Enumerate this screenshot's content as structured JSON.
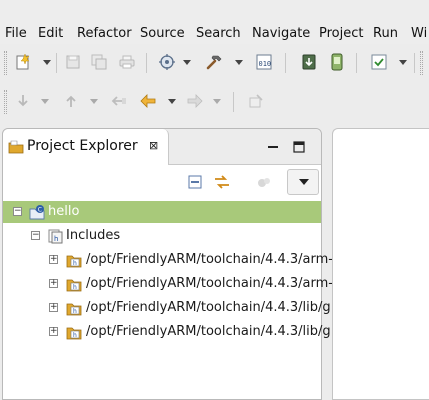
{
  "menu": {
    "file": "File",
    "edit": "Edit",
    "refactor": "Refactor",
    "source": "Source",
    "search": "Search",
    "navigate": "Navigate",
    "project": "Project",
    "run": "Run",
    "window": "Wi"
  },
  "toolbar1": {
    "icons": [
      "new-wizard-icon",
      "save-icon",
      "save-all-icon",
      "print-icon",
      "debug-settings-icon",
      "build-hammer-icon",
      "binary-icon",
      "download-icon",
      "device-icon",
      "task-check-icon"
    ]
  },
  "toolbar2": {
    "icons": [
      "next-annotation-icon",
      "previous-annotation-icon",
      "last-edit-location-icon",
      "back-icon",
      "forward-icon",
      "pin-editor-icon"
    ]
  },
  "explorer": {
    "title": "Project Explorer",
    "close_glyph": "⊠",
    "view_menu_icon": "view-menu-icon"
  },
  "tree": {
    "project": "hello",
    "includes": "Includes",
    "paths": [
      "/opt/FriendlyARM/toolchain/4.4.3/arm-",
      "/opt/FriendlyARM/toolchain/4.4.3/arm-",
      "/opt/FriendlyARM/toolchain/4.4.3/lib/g",
      "/opt/FriendlyARM/toolchain/4.4.3/lib/g"
    ]
  },
  "colors": {
    "selection": "#a8c97a",
    "folder": "#e0a82e",
    "background": "#ececec"
  }
}
